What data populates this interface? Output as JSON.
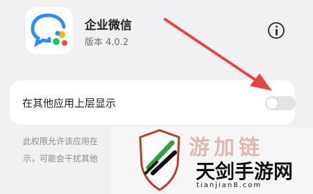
{
  "app": {
    "name": "企业微信",
    "version": "版本 4.0.2",
    "icon": "wecom-logo-icon",
    "info_icon": "info-icon"
  },
  "setting": {
    "label": "在其他应用上层显示",
    "enabled": false
  },
  "description": {
    "line1": "此权限允许该应用在",
    "line2": "示，可能会干扰其他"
  },
  "watermark": {
    "brand": "天剑手游网",
    "url": "tianjian8.com",
    "faded_text": "游加链"
  },
  "colors": {
    "arrow": "#e8424a",
    "toggle_off": "#e3e3e6",
    "logo_blue": "#2f8ff0",
    "logo_green": "#24c05c",
    "logo_yellow": "#f6b511"
  }
}
